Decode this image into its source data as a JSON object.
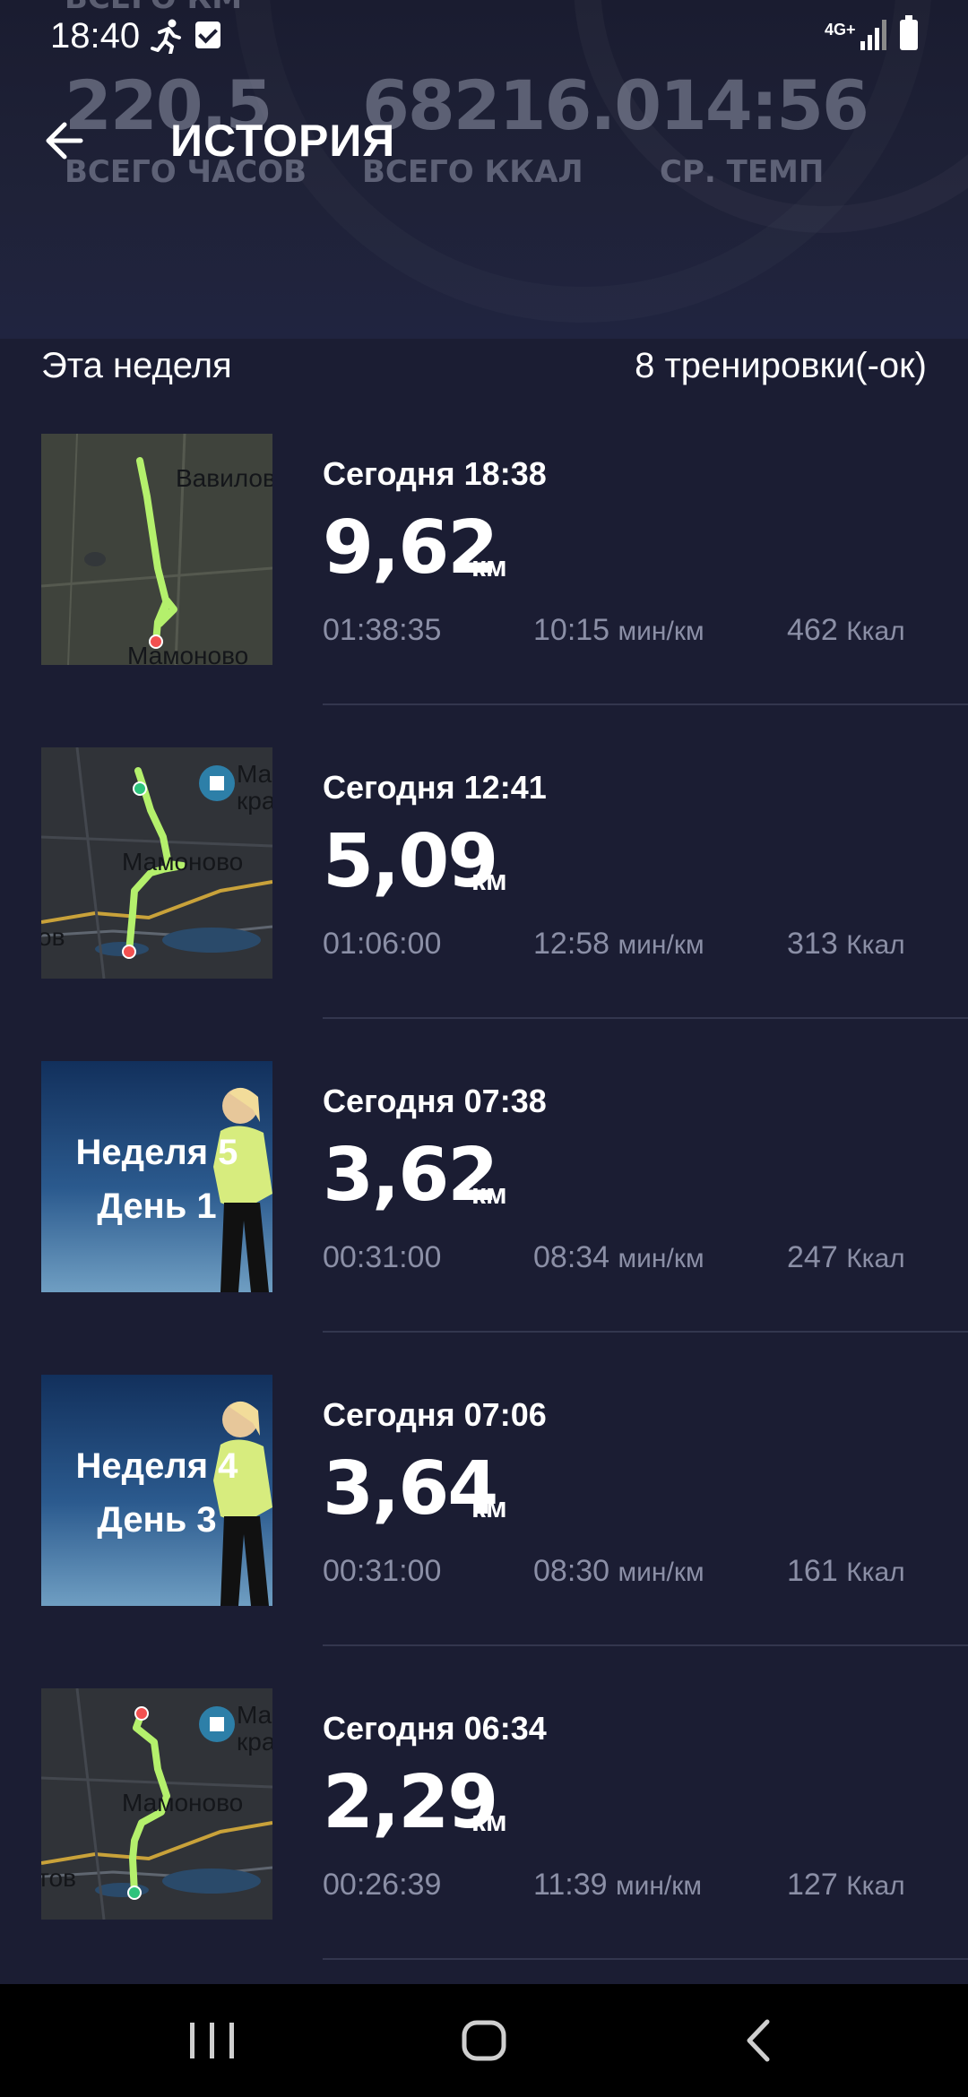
{
  "status_bar": {
    "time": "18:40",
    "network": "4G+",
    "icons": [
      "running-icon",
      "checkbox-icon",
      "signal-icon",
      "battery-icon"
    ]
  },
  "header": {
    "title": "ИСТОРИЯ",
    "stats_top_label": "ВСЕГО КМ",
    "stats": [
      {
        "value": "220.5",
        "label": "ВСЕГО ЧАСОВ"
      },
      {
        "value": "68216.0",
        "label": "ВСЕГО ККАЛ"
      },
      {
        "value": "14:56",
        "label": "СР. ТЕМП"
      }
    ]
  },
  "section": {
    "label": "Эта неделя",
    "count": "8 тренировки(-ок)"
  },
  "workouts": [
    {
      "date": "Сегодня 18:38",
      "distance": "9,62",
      "unit": "км",
      "duration": "01:38:35",
      "pace": "10:15",
      "pace_unit": "мин/км",
      "kcal": "462",
      "kcal_unit": "Ккал",
      "map_labels": [
        "Вавилов",
        "Мамоново"
      ]
    },
    {
      "date": "Сегодня 12:41",
      "distance": "5,09",
      "unit": "км",
      "duration": "01:06:00",
      "pace": "12:58",
      "pace_unit": "мин/км",
      "kcal": "313",
      "kcal_unit": "Ккал",
      "map_labels": [
        "Ма",
        "кра",
        "Мамоново",
        "ов"
      ]
    },
    {
      "date": "Сегодня 07:38",
      "distance": "3,62",
      "unit": "км",
      "duration": "00:31:00",
      "pace": "08:34",
      "pace_unit": "мин/км",
      "kcal": "247",
      "kcal_unit": "Ккал",
      "promo_line1": "Неделя 5",
      "promo_line2": "День 1"
    },
    {
      "date": "Сегодня 07:06",
      "distance": "3,64",
      "unit": "км",
      "duration": "00:31:00",
      "pace": "08:30",
      "pace_unit": "мин/км",
      "kcal": "161",
      "kcal_unit": "Ккал",
      "promo_line1": "Неделя 4",
      "promo_line2": "День 3"
    },
    {
      "date": "Сегодня 06:34",
      "distance": "2,29",
      "unit": "км",
      "duration": "00:26:39",
      "pace": "11:39",
      "pace_unit": "мин/км",
      "kcal": "127",
      "kcal_unit": "Ккал",
      "map_labels": [
        "Ма",
        "кра",
        "Мамоново",
        "тов"
      ]
    }
  ],
  "colors": {
    "background": "#1b1d33",
    "route": "#b4f06c",
    "start_dot": "#2ec37c",
    "end_dot": "#f25050",
    "muted_text": "#8b8fa6"
  },
  "nav": {
    "icons": [
      "recents-icon",
      "home-icon",
      "back-icon"
    ]
  }
}
